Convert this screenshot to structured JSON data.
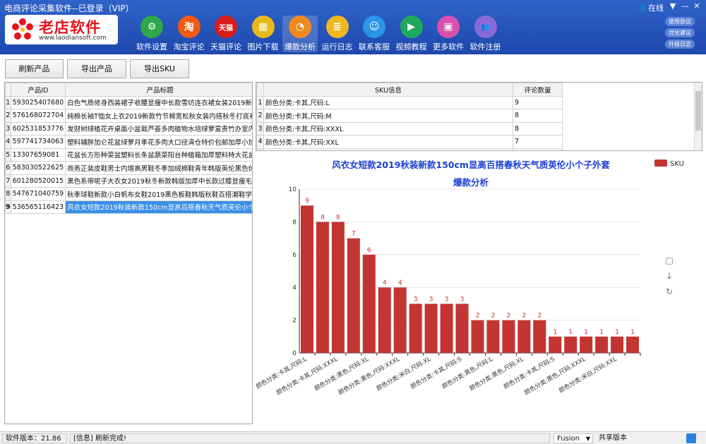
{
  "window": {
    "title": "电商评论采集软件--已登录（VIP）",
    "status": "在线"
  },
  "logo": {
    "name": "老店软件",
    "url": "www.laodiansoft.com"
  },
  "toolbar": [
    {
      "label": "软件设置",
      "glyph": "⚙",
      "icon": "gear-icon",
      "color": "#2fa84a"
    },
    {
      "label": "淘宝评论",
      "glyph": "淘",
      "icon": "taobao-icon",
      "color": "#f25a12"
    },
    {
      "label": "天猫评论",
      "glyph": "天猫",
      "icon": "tmall-icon",
      "color": "#d91c1c"
    },
    {
      "label": "图片下载",
      "glyph": "▦",
      "icon": "cart-icon",
      "color": "#e8b91b"
    },
    {
      "label": "爆款分析",
      "glyph": "◔",
      "icon": "pie-chart-icon",
      "color": "#f0891e"
    },
    {
      "label": "运行日志",
      "glyph": "≣",
      "icon": "log-icon",
      "color": "#f0b820"
    },
    {
      "label": "联系客服",
      "glyph": "☺",
      "icon": "qq-icon",
      "color": "#2b95e8"
    },
    {
      "label": "视频教程",
      "glyph": "▶",
      "icon": "video-icon",
      "color": "#1eaa5c"
    },
    {
      "label": "更多软件",
      "glyph": "▣",
      "icon": "box-icon",
      "color": "#d94fb0"
    },
    {
      "label": "软件注册",
      "glyph": "👥",
      "icon": "users-icon",
      "color": "#8b6ad8"
    }
  ],
  "side_buttons": [
    "使用协议",
    "优化建议",
    "升级日志"
  ],
  "actions": {
    "refresh": "刷新产品",
    "export_products": "导出产品",
    "export_sku": "导出SKU"
  },
  "products": {
    "headers": [
      "产品ID",
      "产品标题"
    ],
    "rows": [
      [
        "593025407680",
        "白色气质修身西装裙子收腰显瘦中长款雪纺连衣裙女装2019新款夏装"
      ],
      [
        "576168072704",
        "纯棉长袖T恤女上衣2019新款竹节棉宽松秋女装内搭秋冬打底衫潮"
      ],
      [
        "602531853776",
        "发财树绿植花卉桌面小盆栽芦荟多肉植物水培绿萝富贵竹办室内好养"
      ],
      [
        "597741734063",
        "塑料辅胖加仑花盆绿萝月季花多肉大口径清仓特价包邮加厚小加仑盆"
      ],
      [
        "13307659081",
        "花盆长方形种菜盆塑料长条盆蔬菜阳台种植箱加厚塑料特大花盆托盘"
      ],
      [
        "583030522625",
        "商务正装皮鞋男士内增高男鞋冬季加绒棉鞋青年韩版英伦黑色休闲鞋"
      ],
      [
        "601280520015",
        "黑色系带呢子大衣女2019秋冬新款韩版加厚中长款过膝显瘦毛呢外套"
      ],
      [
        "547671040759",
        "秋季球鞋新款小白帆布女鞋2019黑色板鞋韩版秋鞋百搭潮鞋学生布鞋"
      ],
      [
        "536565116423",
        "风衣女短款2019秋装新款150cm显高百搭春秋天气质英伦小个子外套"
      ]
    ],
    "selected": 8
  },
  "sku": {
    "headers": [
      "SKU信息",
      "评论数量"
    ],
    "rows": [
      [
        "颜色分类:卡其,尺码:L",
        "9"
      ],
      [
        "颜色分类:卡其,尺码:M",
        "8"
      ],
      [
        "颜色分类:卡其,尺码:XXXL",
        "8"
      ],
      [
        "颜色分类:卡其,尺码:XXL",
        "7"
      ],
      [
        "颜色分类:黑色,尺码:XL",
        "6"
      ]
    ]
  },
  "chart_data": {
    "type": "bar",
    "title": "风衣女短款2019秋装新款150cm显高百搭春秋天气质英伦小个子外套",
    "subtitle": "爆款分析",
    "legend": "SKU",
    "legend_position": "top-right",
    "color": "#c23531",
    "ylim": [
      0,
      10
    ],
    "yticks": [
      0,
      2,
      4,
      6,
      8,
      10
    ],
    "grid": true,
    "categories": [
      "颜色分类:卡其,尺码:L",
      "颜色分类:卡其,尺码:M",
      "颜色分类:卡其,尺码:XXXL",
      "颜色分类:卡其,尺码:XXL",
      "颜色分类:黑色,尺码:XL",
      "颜色分类:卡其,尺码:XL",
      "颜色分类:黑色,尺码:XXXL",
      "颜色分类:米白,尺码:XXL",
      "颜色分类:米白,尺码:XL",
      "颜色分类:黑色,尺码:XXL",
      "颜色分类:卡其,尺码:S",
      "颜色分类:米白,尺码:XXXL",
      "颜色分类:黑色,尺码:L",
      "颜色分类:米白,尺码:L",
      "颜色分类:黑色,尺码:XL",
      "颜色分类:米白,尺码:M",
      "颜色分类:卡其,尺码:S",
      "颜色分类:米白,尺码:S",
      "颜色分类:黑色,尺码:XXXL",
      "颜色分类:黑色,尺码:S",
      "颜色分类:米白,尺码:XXL",
      "颜色分类:黑色,尺码:M"
    ],
    "values": [
      9,
      8,
      8,
      7,
      6,
      4,
      4,
      3,
      3,
      3,
      3,
      2,
      2,
      2,
      2,
      2,
      1,
      1,
      1,
      1,
      1,
      1
    ]
  },
  "status": {
    "version": "软件版本：21.86",
    "message": "[信息] 刷新完成!",
    "engine": "Fusion",
    "share": "共享版本"
  }
}
